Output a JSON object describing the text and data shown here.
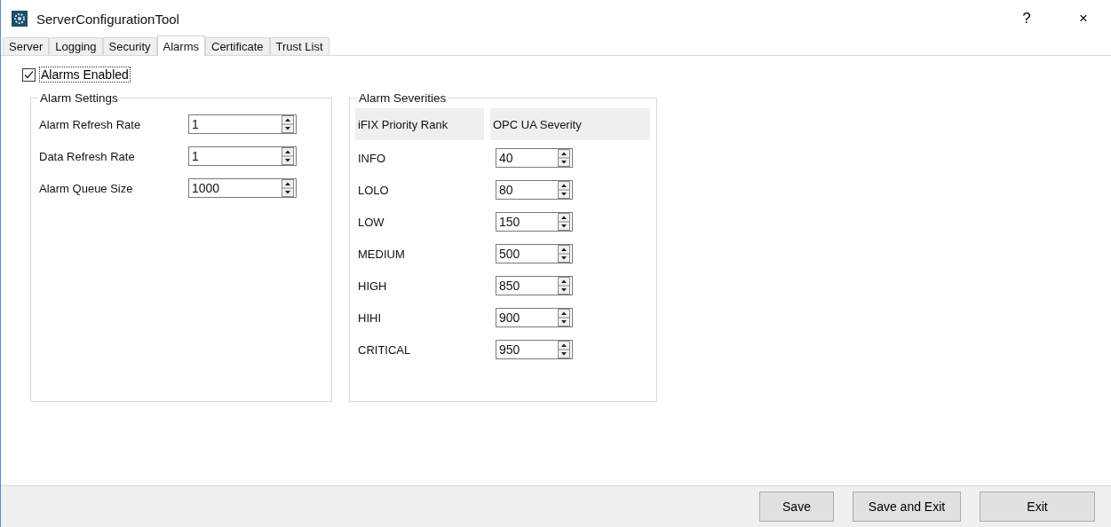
{
  "window": {
    "title": "ServerConfigurationTool",
    "help": "?",
    "close": "×"
  },
  "tabs": [
    {
      "label": "Server",
      "selected": false
    },
    {
      "label": "Logging",
      "selected": false
    },
    {
      "label": "Security",
      "selected": false
    },
    {
      "label": "Alarms",
      "selected": true
    },
    {
      "label": "Certificate",
      "selected": false
    },
    {
      "label": "Trust List",
      "selected": false
    }
  ],
  "alarms_enabled": {
    "label": "Alarms Enabled",
    "checked": true
  },
  "alarm_settings": {
    "title": "Alarm Settings",
    "fields": [
      {
        "label": "Alarm Refresh Rate",
        "value": "1"
      },
      {
        "label": "Data Refresh Rate",
        "value": "1"
      },
      {
        "label": "Alarm Queue Size",
        "value": "1000"
      }
    ]
  },
  "alarm_severities": {
    "title": "Alarm Severities",
    "columns": [
      "iFIX Priority Rank",
      "OPC UA Severity"
    ],
    "rows": [
      {
        "rank": "INFO",
        "severity": "40"
      },
      {
        "rank": "LOLO",
        "severity": "80"
      },
      {
        "rank": "LOW",
        "severity": "150"
      },
      {
        "rank": "MEDIUM",
        "severity": "500"
      },
      {
        "rank": "HIGH",
        "severity": "850"
      },
      {
        "rank": "HIHI",
        "severity": "900"
      },
      {
        "rank": "CRITICAL",
        "severity": "950"
      }
    ]
  },
  "buttons": [
    "Save",
    "Save and Exit",
    "Exit"
  ]
}
